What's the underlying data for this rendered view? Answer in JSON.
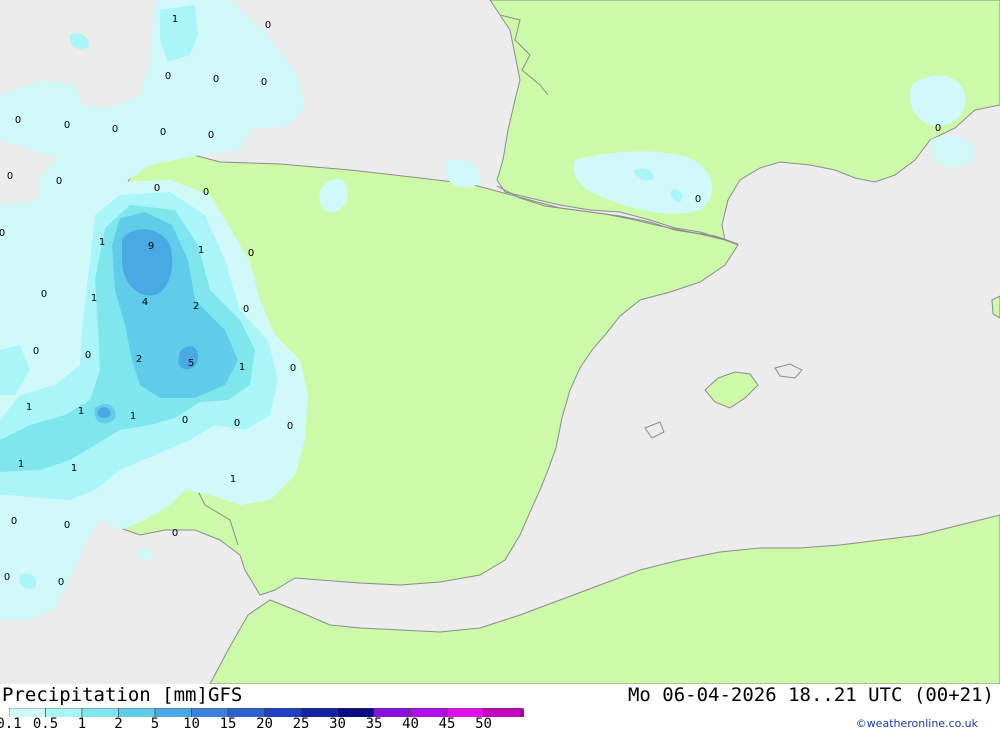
{
  "colors": {
    "sea": "#ececec",
    "land": "#ccfaa8",
    "border": "#8c8c8c",
    "precip_01": "#d2f9fa",
    "precip_05": "#aaf5f8",
    "precip_1": "#7fe6ee",
    "precip_2": "#5fcde9",
    "precip_5": "#49a9e3",
    "precip_10": "#3f80df"
  },
  "header": {
    "title": "Precipitation [mm]",
    "model": "GFS",
    "valid_time": "Mo 06-04-2026 18..21 UTC (00+21)"
  },
  "legend": {
    "labels": [
      "0.1",
      "0.5",
      "1",
      "2",
      "5",
      "10",
      "15",
      "20",
      "25",
      "30",
      "35",
      "40",
      "45",
      "50"
    ],
    "colors": [
      "#d2f9fa",
      "#aaf5f8",
      "#7fe6ee",
      "#5fcde9",
      "#49a9e3",
      "#3f80df",
      "#2f60cf",
      "#2040bf",
      "#1224a0",
      "#0c0a80",
      "#8a10e0",
      "#b20ee8",
      "#e010e8",
      "#c00ac0",
      "#a00898"
    ]
  },
  "credit": "©weatheronline.co.uk",
  "map_values": [
    "1",
    "0",
    "0",
    "0",
    "0",
    "0",
    "0",
    "0",
    "0",
    "0",
    "0",
    "0",
    "0",
    "0",
    "0",
    "0",
    "0",
    "1",
    "9",
    "1",
    "0",
    "0",
    "1",
    "4",
    "2",
    "0",
    "0",
    "0",
    "2",
    "5",
    "1",
    "0",
    "1",
    "1",
    "1",
    "0",
    "0",
    "0",
    "1",
    "1",
    "1",
    "0",
    "0",
    "0",
    "0",
    "0",
    "0",
    "0"
  ]
}
